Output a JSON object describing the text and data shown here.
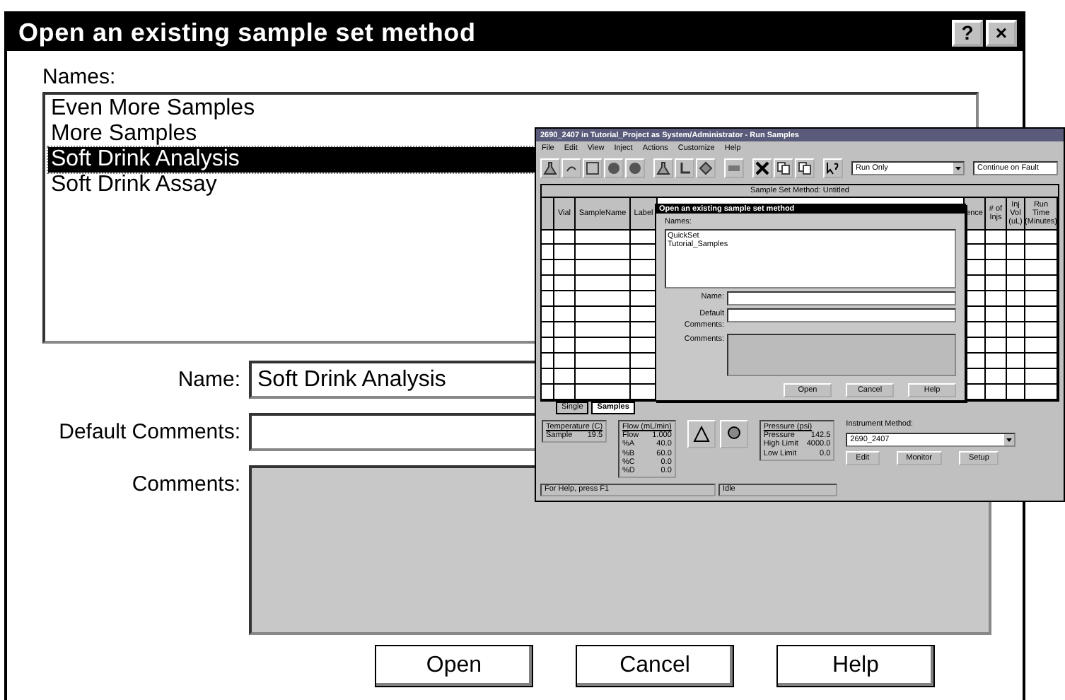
{
  "dialog": {
    "title": "Open an existing sample set method",
    "title_buttons": [
      "?",
      "×"
    ],
    "names_label": "Names:",
    "names": [
      {
        "text": "Even More Samples",
        "selected": false
      },
      {
        "text": "More Samples",
        "selected": false
      },
      {
        "text": "Soft Drink Analysis",
        "selected": true
      },
      {
        "text": "Soft Drink Assay",
        "selected": false
      }
    ],
    "name": {
      "label": "Name:",
      "value": "Soft Drink Analysis"
    },
    "default_comments": {
      "label": "Default Comments:"
    },
    "comments": {
      "label": "Comments:"
    },
    "buttons": [
      "Open",
      "Cancel",
      "Help"
    ]
  },
  "inset_window": {
    "title": "2690_2407 in Tutorial_Project as System/Administrator - Run Samples",
    "menu": [
      "File",
      "Edit",
      "View",
      "Inject",
      "Actions",
      "Customize",
      "Help"
    ],
    "combos": [
      "Run Only",
      "Continue on Fault"
    ],
    "table_title": "Sample Set Method: Untitled",
    "left_columns": [
      "",
      "Vial",
      "SampleName",
      "Label"
    ],
    "right_columns": [
      "ence",
      "# of Injs",
      "Inj Vol (uL)",
      "Run Time (Minutes)"
    ],
    "sheet_tabs": [
      {
        "label": "Single",
        "selected": false
      },
      {
        "label": "Samples",
        "selected": true
      }
    ],
    "temperature": {
      "title": "Temperature (C)",
      "rows": [
        [
          "Sample",
          "19.5"
        ]
      ]
    },
    "flow": {
      "title": "Flow (mL/min)",
      "rows": [
        [
          "Flow",
          "1.000"
        ],
        [
          "%A",
          "40.0"
        ],
        [
          "%B",
          "60.0"
        ],
        [
          "%C",
          "0.0"
        ],
        [
          "%D",
          "0.0"
        ]
      ]
    },
    "pressure": {
      "title": "Pressure (psi)",
      "rows": [
        [
          "Pressure",
          "142.5"
        ],
        [
          "High Limit",
          "4000.0"
        ],
        [
          "Low Limit",
          "0.0"
        ]
      ]
    },
    "instrument_method": {
      "label": "Instrument Method:",
      "value": "2690_2407",
      "buttons": [
        "Edit",
        "Monitor",
        "Setup"
      ]
    },
    "status": [
      "For Help, press F1",
      "Idle"
    ],
    "dialog": {
      "title": "Open an existing sample set method",
      "names_label": "Names:",
      "names": [
        "QuickSet",
        "Tutorial_Samples"
      ],
      "labels": [
        "Name:",
        "Default Comments:",
        "Comments:"
      ],
      "buttons": [
        "Open",
        "Cancel",
        "Help"
      ]
    }
  }
}
